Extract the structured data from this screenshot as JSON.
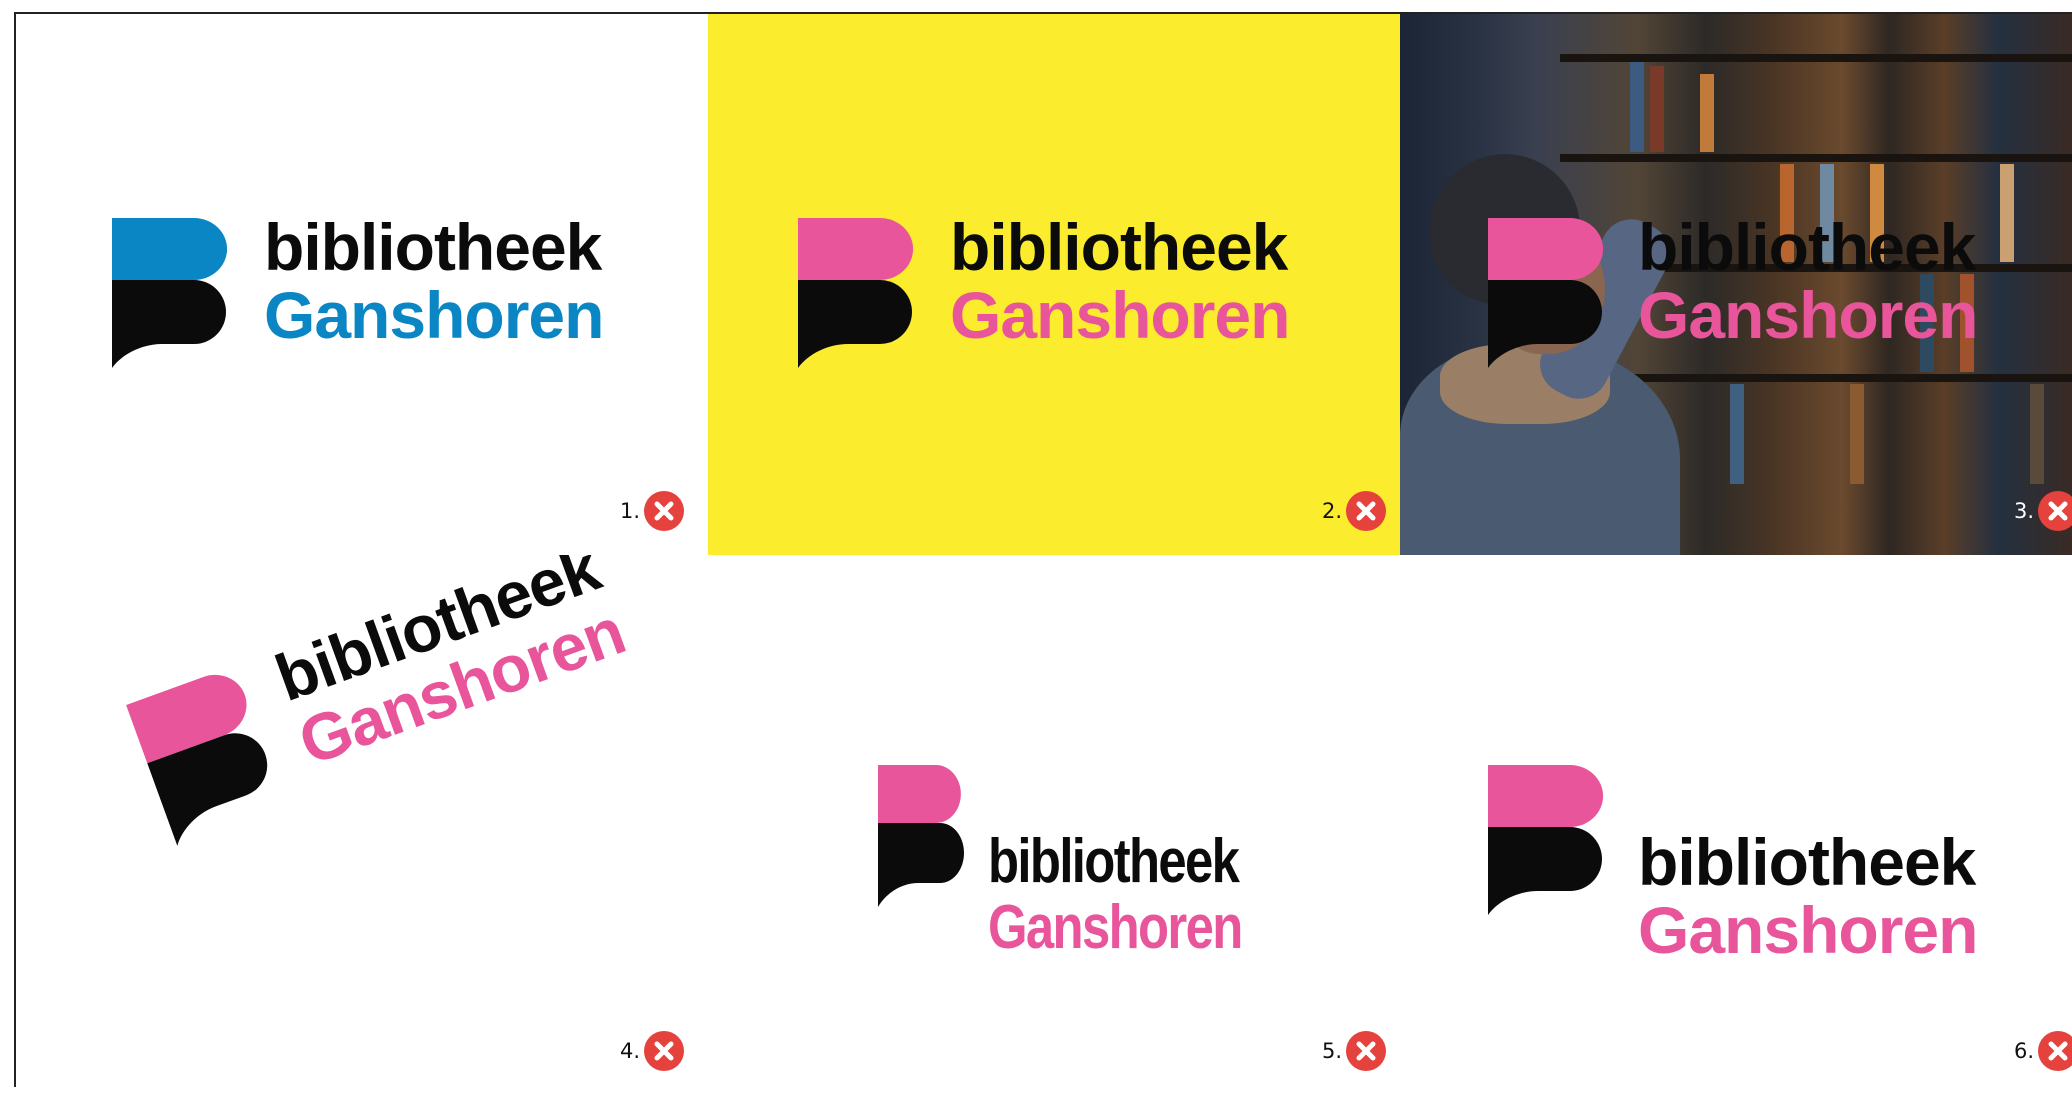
{
  "logo": {
    "line1": "bibliotheek",
    "line2": "Ganshoren"
  },
  "colors": {
    "blue": "#0a86c4",
    "pink": "#e8559b",
    "black": "#0b0b0b",
    "yellow": "#fbec2e",
    "error_red": "#e5413d"
  },
  "panels": [
    {
      "number": "1.",
      "icon": "close-icon",
      "description_of_error": ""
    },
    {
      "number": "2.",
      "icon": "close-icon"
    },
    {
      "number": "3.",
      "icon": "close-icon"
    },
    {
      "number": "4.",
      "icon": "close-icon"
    },
    {
      "number": "5.",
      "icon": "close-icon"
    },
    {
      "number": "6.",
      "icon": "close-icon"
    }
  ]
}
